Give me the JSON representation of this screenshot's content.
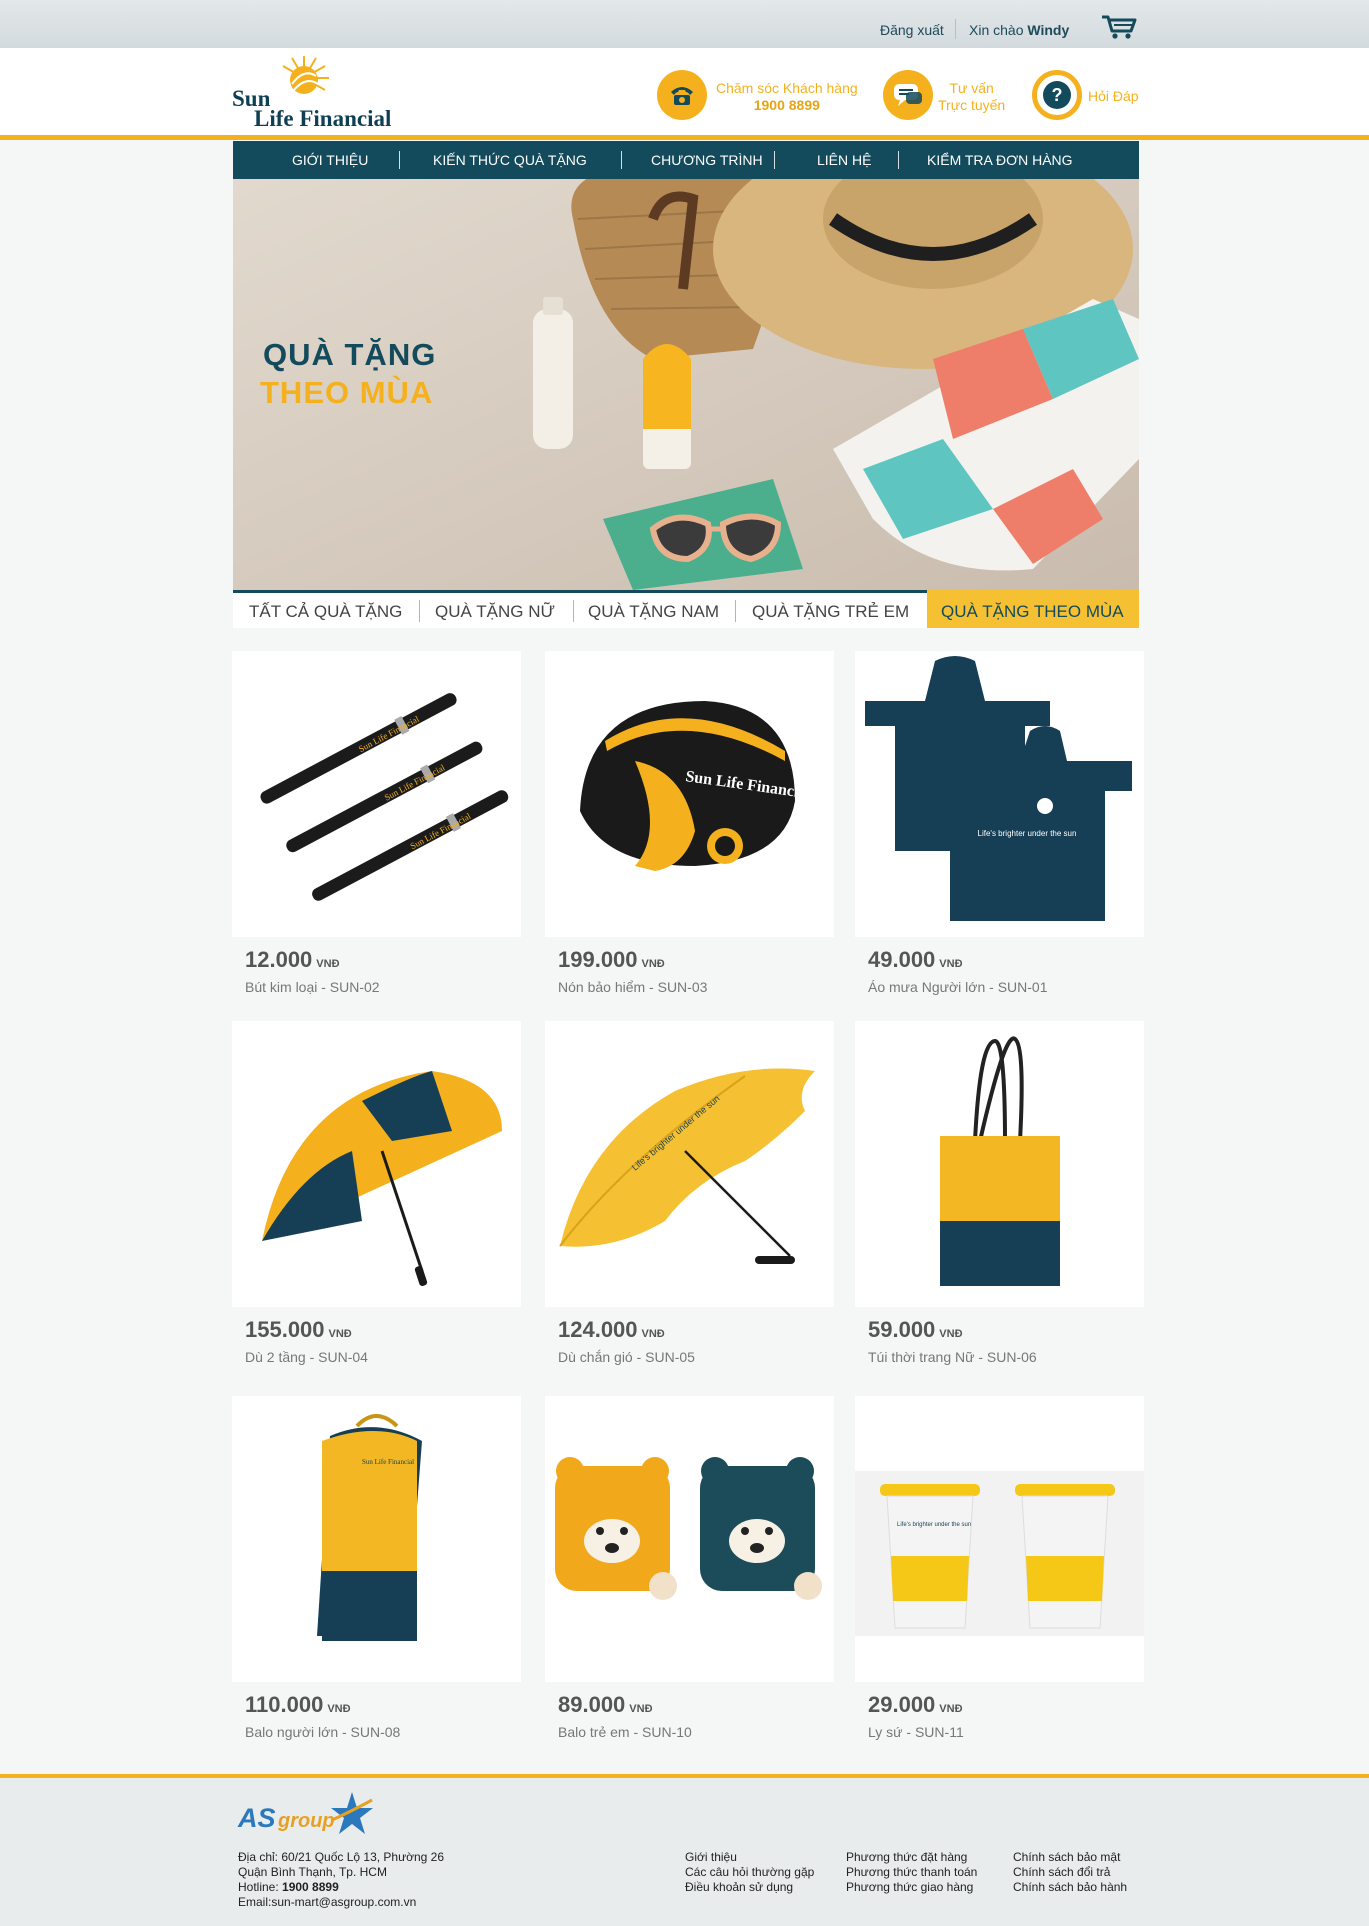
{
  "topbar": {
    "logout": "Đăng xuất",
    "greeting": "Xin chào",
    "username": "Windy"
  },
  "brand": {
    "line1": "Sun",
    "line2": "Life Financial"
  },
  "header": {
    "support_label": "Chăm sóc Khách hàng",
    "support_phone": "1900 8899",
    "advice_line1": "Tư vấn",
    "advice_line2": "Trực tuyến",
    "faq_label": "Hỏi Đáp"
  },
  "nav": {
    "items": [
      "GIỚI THIỆU",
      "KIẾN THỨC QUÀ TẶNG",
      "CHƯƠNG TRÌNH",
      "LIÊN HỆ",
      "KIỂM TRA ĐƠN HÀNG"
    ]
  },
  "banner": {
    "title_line1": "QUÀ TẶNG",
    "title_line2": "THEO MÙA"
  },
  "tabs": {
    "items": [
      "TẤT CẢ QUÀ TẶNG",
      "QUÀ TẶNG NỮ",
      "QUÀ TẶNG NAM",
      "QUÀ TẶNG TRẺ EM"
    ],
    "active": "QUÀ TẶNG THEO MÙA"
  },
  "currency": "VNĐ",
  "products": [
    {
      "price": "12.000",
      "name": "Bút kim loại - SUN-02",
      "icon": "pen-icon"
    },
    {
      "price": "199.000",
      "name": "Nón bảo hiểm - SUN-03",
      "icon": "helmet-icon"
    },
    {
      "price": "49.000",
      "name": "Áo mưa Người lớn - SUN-01",
      "icon": "raincoat-icon"
    },
    {
      "price": "155.000",
      "name": "Dù 2 tầng - SUN-04",
      "icon": "umbrella-icon"
    },
    {
      "price": "124.000",
      "name": "Dù chắn gió - SUN-05",
      "icon": "umbrella-icon"
    },
    {
      "price": "59.000",
      "name": "Túi thời trang Nữ - SUN-06",
      "icon": "tote-bag-icon"
    },
    {
      "price": "110.000",
      "name": "Balo người lớn - SUN-08",
      "icon": "backpack-icon"
    },
    {
      "price": "89.000",
      "name": "Balo trẻ em - SUN-10",
      "icon": "kids-backpack-icon"
    },
    {
      "price": "29.000",
      "name": "Ly sứ - SUN-11",
      "icon": "cup-icon"
    }
  ],
  "product_imprint": {
    "brand": "Sun Life Financial",
    "slogan": "Life's brighter under the sun"
  },
  "footer": {
    "logo_as": "AS",
    "logo_group": "group",
    "address_line1": "Địa chỉ: 60/21 Quốc Lộ 13, Phường 26",
    "address_line2": "Quận Bình Thạnh, Tp. HCM",
    "hotline_label": "Hotline:",
    "hotline": "1900 8899",
    "email": "Email:sun-mart@asgroup.com.vn",
    "col1": [
      "Giới thiệu",
      "Các câu hỏi thường gặp",
      "Điều khoản sử dụng"
    ],
    "col2": [
      "Phương thức đặt hàng",
      "Phương thức thanh toán",
      "Phương thức giao hàng"
    ],
    "col3": [
      "Chính sách bảo mật",
      "Chính sách đổi trả",
      "Chính sách bảo hành"
    ]
  },
  "colors": {
    "brand_navy": "#134a5c",
    "brand_yellow": "#f5b11d"
  }
}
